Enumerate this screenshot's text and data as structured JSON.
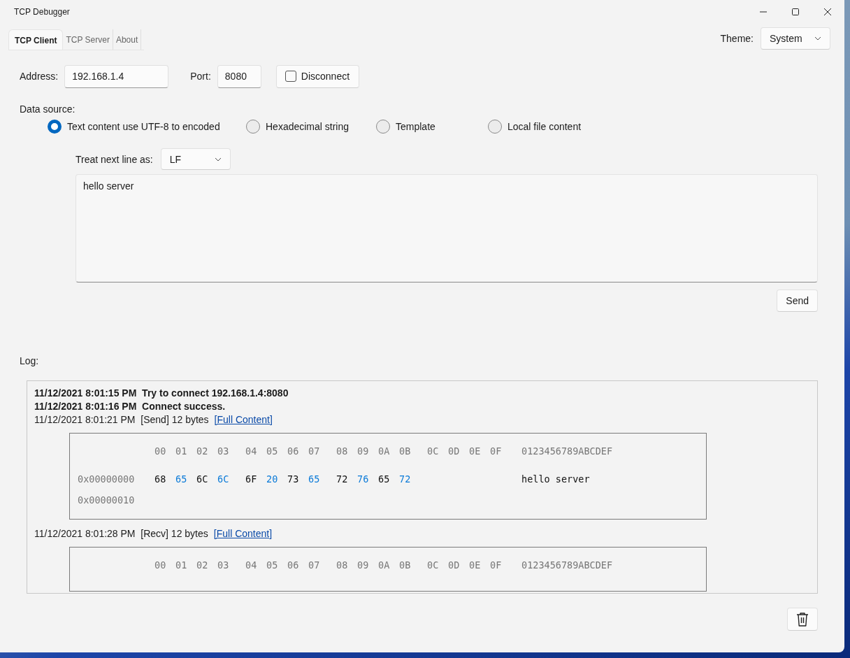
{
  "window": {
    "title": "TCP Debugger"
  },
  "tabs": [
    {
      "label": "TCP Client",
      "selected": true
    },
    {
      "label": "TCP Server",
      "selected": false
    },
    {
      "label": "About",
      "selected": false
    }
  ],
  "theme": {
    "label": "Theme:",
    "value": "System"
  },
  "connection": {
    "address_label": "Address:",
    "address": "192.168.1.4",
    "port_label": "Port:",
    "port": "8080",
    "toggle": {
      "label": "Disconnect",
      "checked": false
    }
  },
  "data_source": {
    "label": "Data source:",
    "options": [
      {
        "label": "Text content use UTF-8 to encoded",
        "selected": true
      },
      {
        "label": "Hexadecimal string",
        "selected": false
      },
      {
        "label": "Template",
        "selected": false
      },
      {
        "label": "Local file content",
        "selected": false
      }
    ]
  },
  "newline": {
    "label": "Treat next line as:",
    "value": "LF"
  },
  "message": {
    "value": "hello server"
  },
  "send_button": "Send",
  "log": {
    "label": "Log:",
    "entries": [
      {
        "kind": "event",
        "time": "11/12/2021 8:01:15 PM",
        "message": "Try to connect 192.168.1.4:8080"
      },
      {
        "kind": "event",
        "time": "11/12/2021 8:01:16 PM",
        "message": "Connect success."
      },
      {
        "kind": "transfer",
        "time": "11/12/2021 8:01:21 PM",
        "direction": "[Send]",
        "size": "12 bytes",
        "link": "[Full Content]",
        "dump": {
          "header": [
            "00",
            "01",
            "02",
            "03",
            "04",
            "05",
            "06",
            "07",
            "08",
            "09",
            "0A",
            "0B",
            "0C",
            "0D",
            "0E",
            "0F"
          ],
          "ascii_header": "0123456789ABCDEF",
          "rows": [
            {
              "offset": "0x00000000",
              "bytes": [
                {
                  "text": "68",
                  "highlight": false
                },
                {
                  "text": "65",
                  "highlight": true
                },
                {
                  "text": "6C",
                  "highlight": false
                },
                {
                  "text": "6C",
                  "highlight": true
                },
                {
                  "text": "6F",
                  "highlight": false
                },
                {
                  "text": "20",
                  "highlight": true
                },
                {
                  "text": "73",
                  "highlight": false
                },
                {
                  "text": "65",
                  "highlight": true
                },
                {
                  "text": "72",
                  "highlight": false
                },
                {
                  "text": "76",
                  "highlight": true
                },
                {
                  "text": "65",
                  "highlight": false
                },
                {
                  "text": "72",
                  "highlight": true
                }
              ],
              "ascii": "hello server"
            },
            {
              "offset": "0x00000010"
            }
          ]
        }
      },
      {
        "kind": "transfer",
        "time": "11/12/2021 8:01:28 PM",
        "direction": "[Recv]",
        "size": "12 bytes",
        "link": "[Full Content]",
        "dump": {
          "header": [
            "00",
            "01",
            "02",
            "03",
            "04",
            "05",
            "06",
            "07",
            "08",
            "09",
            "0A",
            "0B",
            "0C",
            "0D",
            "0E",
            "0F"
          ],
          "ascii_header": "0123456789ABCDEF"
        }
      }
    ]
  }
}
